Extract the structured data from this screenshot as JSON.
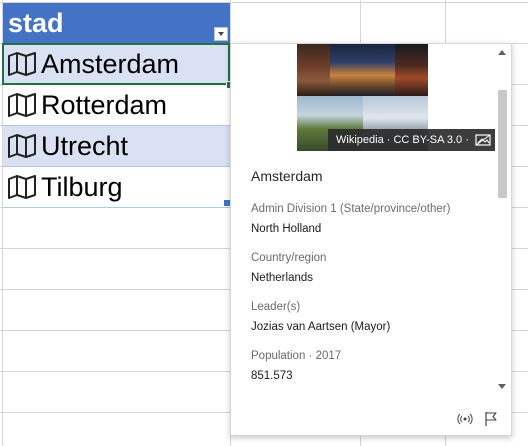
{
  "sheet": {
    "column_header": "stad",
    "rows": [
      {
        "label": "Amsterdam",
        "icon": "map-icon"
      },
      {
        "label": "Rotterdam",
        "icon": "map-icon"
      },
      {
        "label": "Utrecht",
        "icon": "map-icon"
      },
      {
        "label": "Tilburg",
        "icon": "map-icon"
      }
    ],
    "colors": {
      "header": "#4472c4",
      "band": "#d9e1f2",
      "selection": "#217346"
    }
  },
  "card": {
    "title": "Amsterdam",
    "attribution": "Wikipedia · CC BY-SA 3.0 ·",
    "fields": [
      {
        "label": "Admin Division 1 (State/province/other)",
        "value": "North Holland"
      },
      {
        "label": "Country/region",
        "value": "Netherlands"
      },
      {
        "label": "Leader(s)",
        "value": "Jozias van Aartsen (Mayor)"
      },
      {
        "label": "Population · 2017",
        "value": "851.573"
      }
    ],
    "footer_icons": [
      "broadcast-icon",
      "flag-icon"
    ]
  }
}
